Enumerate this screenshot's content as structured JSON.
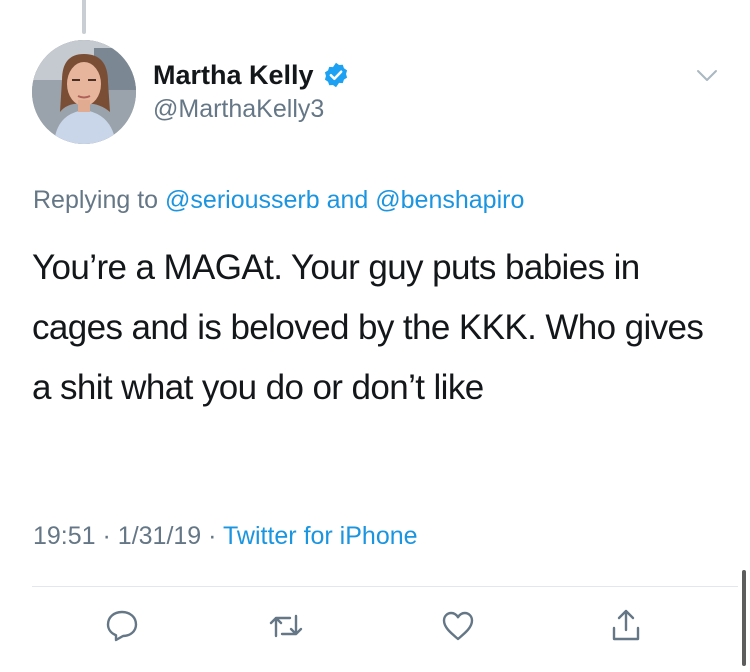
{
  "tweet": {
    "author_name": "Martha Kelly",
    "author_handle": "@MarthaKelly3",
    "replying_prefix": "Replying to",
    "replying_to_1": "@seriousserb",
    "replying_conj": "and",
    "replying_to_2": "@benshapiro",
    "text": "You’re a MAGAt. Your guy puts babies in cages and is beloved by the KKK. Who gives a shit what you do or don’t like",
    "time": "19:51",
    "sep1": "·",
    "date": "1/31/19",
    "sep2": "·",
    "source": "Twitter for iPhone"
  },
  "icons": {
    "verified": "verified-badge-icon",
    "caret": "chevron-down-icon",
    "reply": "reply-bubble-icon",
    "retweet": "retweet-icon",
    "like": "heart-icon",
    "share": "share-icon"
  },
  "colors": {
    "text": "#14171a",
    "secondary": "#657786",
    "link": "#1b95e0",
    "verified": "#1da1f2",
    "divider": "#e1e8ed"
  }
}
